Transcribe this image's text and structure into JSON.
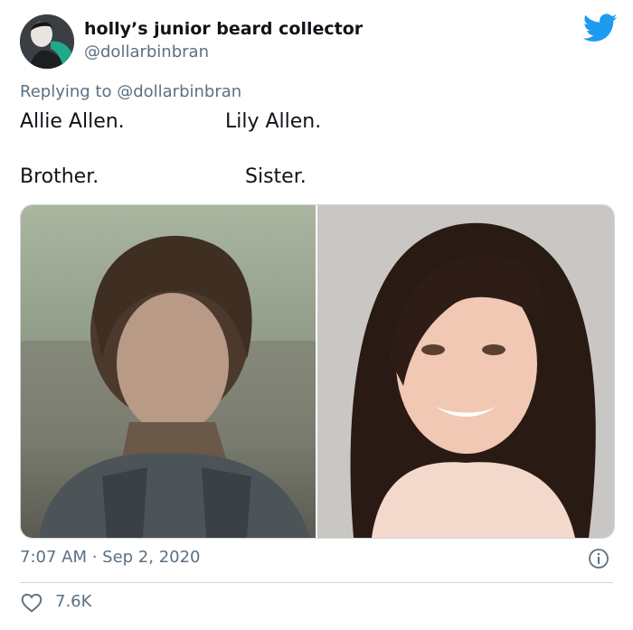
{
  "tweet": {
    "display_name": "holly’s junior beard collector",
    "handle": "@dollarbinbran",
    "replying_prefix": "Replying to ",
    "replying_handle": "@dollarbinbran",
    "lines": {
      "left_top": "Allie Allen.",
      "right_top": "Lily Allen.",
      "left_bottom": "Brother.",
      "right_bottom": "Sister."
    },
    "timestamp": "7:07 AM · Sep 2, 2020",
    "like_count": "7.6K"
  },
  "icons": {
    "brand": "twitter-bird-icon",
    "info": "info-icon",
    "like": "heart-icon"
  },
  "colors": {
    "brand_blue": "#1d9bf0",
    "secondary_text": "#5b7083",
    "border": "#cfd9de"
  }
}
